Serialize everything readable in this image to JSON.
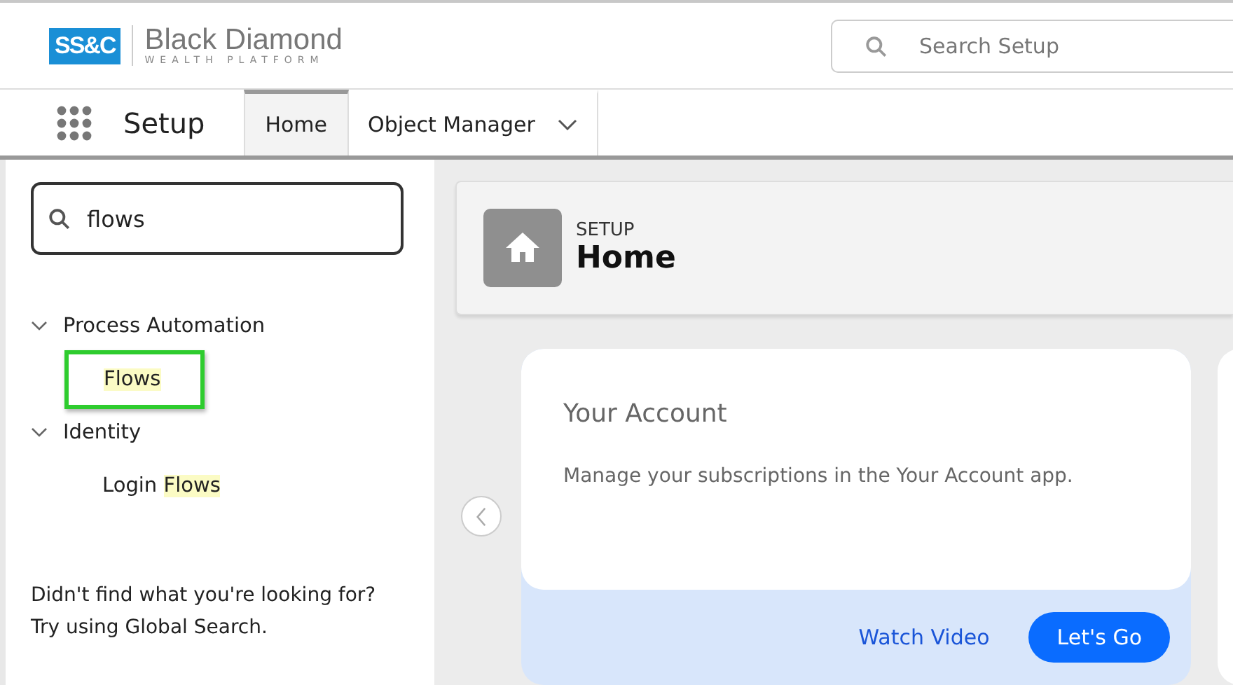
{
  "logo": {
    "mark": "SS&C",
    "name": "Black Diamond",
    "tagline": "WEALTH PLATFORM"
  },
  "search": {
    "placeholder": "Search Setup"
  },
  "nav": {
    "app_name": "Setup",
    "tabs": [
      {
        "label": "Home",
        "selected": true,
        "dropdown": false
      },
      {
        "label": "Object Manager",
        "selected": false,
        "dropdown": true
      }
    ]
  },
  "sidebar": {
    "quick_find": {
      "value": "flows"
    },
    "tree": [
      {
        "label": "Process Automation",
        "expanded": true,
        "children": [
          {
            "label": [
              {
                "text": "Flows",
                "highlight": true
              }
            ],
            "selected": true
          }
        ]
      },
      {
        "label": "Identity",
        "expanded": true,
        "children": [
          {
            "label": [
              {
                "text": "Login ",
                "highlight": false
              },
              {
                "text": "Flows",
                "highlight": true
              }
            ],
            "selected": false
          }
        ]
      }
    ],
    "help": [
      "Didn't find what you're looking for?",
      "Try using Global Search."
    ]
  },
  "page_header": {
    "eyebrow": "SETUP",
    "title": "Home"
  },
  "card": {
    "title": "Your Account",
    "description": "Manage your subscriptions in the Your Account app.",
    "link": "Watch Video",
    "button": "Let's Go"
  }
}
